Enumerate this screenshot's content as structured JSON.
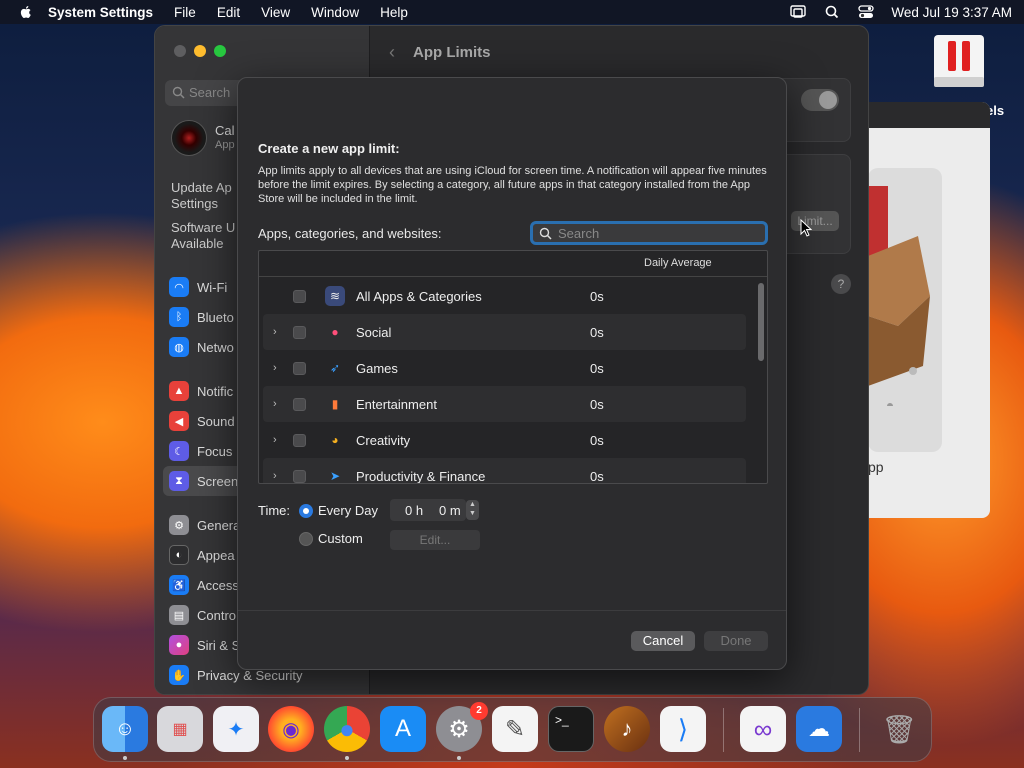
{
  "menubar": {
    "app_name": "System Settings",
    "menus": [
      "File",
      "Edit",
      "View",
      "Window",
      "Help"
    ],
    "datetime": "Wed Jul 19  3:37 AM"
  },
  "sidebar": {
    "search_placeholder": "Search",
    "account_name": "Cal",
    "account_sub": "App",
    "update_1": "Update Ap",
    "update_1b": "Settings",
    "update_2": "Software U",
    "update_2b": "Available",
    "items": [
      {
        "label": "Wi-Fi",
        "color": "#1a7cf5",
        "icon": "wifi-icon"
      },
      {
        "label": "Blueto",
        "color": "#1a7cf5",
        "icon": "bluetooth-icon"
      },
      {
        "label": "Netwo",
        "color": "#1a7cf5",
        "icon": "network-icon"
      },
      {
        "label": "Notific",
        "color": "#e8413a",
        "icon": "bell-icon"
      },
      {
        "label": "Sound",
        "color": "#e8413a",
        "icon": "speaker-icon"
      },
      {
        "label": "Focus",
        "color": "#5e5ce6",
        "icon": "moon-icon"
      },
      {
        "label": "Screen",
        "color": "#5e5ce6",
        "icon": "hourglass-icon"
      },
      {
        "label": "Genera",
        "color": "#8e8e93",
        "icon": "gear-icon"
      },
      {
        "label": "Appea",
        "color": "#2c2c2e",
        "icon": "appearance-icon"
      },
      {
        "label": "Access",
        "color": "#1a7cf5",
        "icon": "accessibility-icon"
      },
      {
        "label": "Contro",
        "color": "#8e8e93",
        "icon": "control-center-icon"
      },
      {
        "label": "Siri & S",
        "color": "#b050e0",
        "icon": "siri-icon"
      },
      {
        "label": "Privacy & Security",
        "color": "#1a7cf5",
        "icon": "hand-icon"
      }
    ]
  },
  "content": {
    "title": "App Limits",
    "limit_button": "Limit..."
  },
  "other_window": {
    "label": "pp",
    "desktop_label": "els"
  },
  "sheet": {
    "title": "Create a new app limit:",
    "description": "App limits apply to all devices that are using iCloud for screen time. A notification will appear five minutes before the limit expires. By selecting a category, all future apps in that category installed from the App Store will be included in the limit.",
    "list_label": "Apps, categories, and websites:",
    "search_placeholder": "Search",
    "column_daily_average": "Daily Average",
    "rows": [
      {
        "name": "All Apps & Categories",
        "avg": "0s",
        "icon": "layers-icon",
        "color": "#4a6fd8",
        "expandable": false
      },
      {
        "name": "Social",
        "avg": "0s",
        "icon": "chat-bubbles-icon",
        "color": "#ff4f7a",
        "expandable": true
      },
      {
        "name": "Games",
        "avg": "0s",
        "icon": "rocket-icon",
        "color": "#3aa0ff",
        "expandable": true
      },
      {
        "name": "Entertainment",
        "avg": "0s",
        "icon": "popcorn-icon",
        "color": "#ff7a3a",
        "expandable": true
      },
      {
        "name": "Creativity",
        "avg": "0s",
        "icon": "palette-icon",
        "color": "#f5b020",
        "expandable": true
      },
      {
        "name": "Productivity & Finance",
        "avg": "0s",
        "icon": "paper-plane-icon",
        "color": "#3aa0ff",
        "expandable": true
      }
    ],
    "time_label": "Time:",
    "every_day": "Every Day",
    "custom": "Custom",
    "hours": "0 h",
    "minutes": "0 m",
    "edit_button": "Edit...",
    "cancel_button": "Cancel",
    "done_button": "Done"
  },
  "dock": {
    "badge_count": "2",
    "apps": [
      {
        "name": "finder-icon",
        "bg": "#2a8cf0"
      },
      {
        "name": "launchpad-icon",
        "bg": "#d8d8dc"
      },
      {
        "name": "safari-icon",
        "bg": "#f0f0f4"
      },
      {
        "name": "firefox-icon",
        "bg": "transparent"
      },
      {
        "name": "chrome-icon",
        "bg": "transparent"
      },
      {
        "name": "app-store-icon",
        "bg": "#1a8cf5"
      },
      {
        "name": "system-settings-icon",
        "bg": "#8e8e93"
      },
      {
        "name": "textedit-icon",
        "bg": "#f4f4f4"
      },
      {
        "name": "terminal-icon",
        "bg": "#1a1a1a"
      },
      {
        "name": "garageband-icon",
        "bg": "transparent"
      },
      {
        "name": "vscode-icon",
        "bg": "#f4f4f4"
      },
      {
        "name": "visual-studio-icon",
        "bg": "#f4f4f4"
      },
      {
        "name": "weather-icon",
        "bg": "#2a7ae0"
      },
      {
        "name": "trash-icon",
        "bg": "transparent"
      }
    ]
  }
}
